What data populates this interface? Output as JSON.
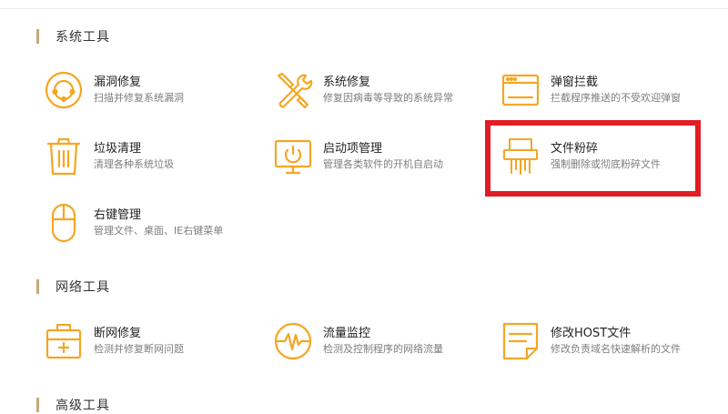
{
  "accent": "#f5a623",
  "highlight_color": "#e01e24",
  "sections": [
    {
      "title": "系统工具"
    },
    {
      "title": "网络工具"
    },
    {
      "title": "高级工具"
    }
  ],
  "tools": {
    "leak_repair": {
      "name": "漏洞修复",
      "desc": "扫描并修复系统漏洞",
      "icon": "shield-scan-icon"
    },
    "system_repair": {
      "name": "系统修复",
      "desc": "修复因病毒等导致的系统异常",
      "icon": "wrench-screwdriver-icon"
    },
    "popup_block": {
      "name": "弹窗拦截",
      "desc": "拦截程序推送的不受欢迎弹窗",
      "icon": "window-icon"
    },
    "junk_clean": {
      "name": "垃圾清理",
      "desc": "清理各种系统垃圾",
      "icon": "trash-icon"
    },
    "startup_manage": {
      "name": "启动项管理",
      "desc": "管理各类软件的开机自启动",
      "icon": "monitor-power-icon"
    },
    "file_shred": {
      "name": "文件粉碎",
      "desc": "强制删除或彻底粉碎文件",
      "icon": "shredder-icon"
    },
    "context_menu": {
      "name": "右键管理",
      "desc": "管理文件、桌面、IE右键菜单",
      "icon": "mouse-icon"
    },
    "net_repair": {
      "name": "断网修复",
      "desc": "检测并修复断网问题",
      "icon": "medkit-icon"
    },
    "traffic_monitor": {
      "name": "流量监控",
      "desc": "检测及控制程序的网络流量",
      "icon": "pulse-gauge-icon"
    },
    "host_edit": {
      "name": "修改HOST文件",
      "desc": "修改负责域名快速解析的文件",
      "icon": "document-icon"
    }
  }
}
